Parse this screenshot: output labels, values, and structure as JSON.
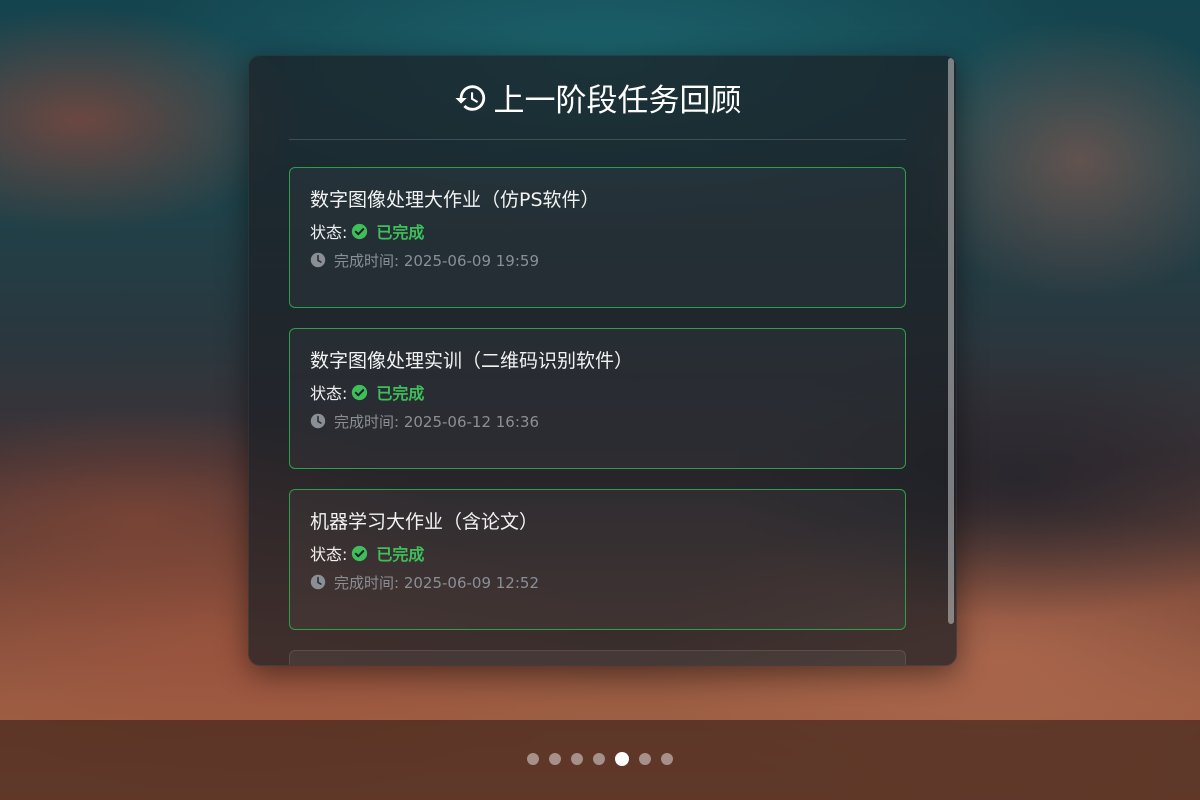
{
  "panel": {
    "title": "上一阶段任务回顾",
    "title_icon": "history-icon"
  },
  "tasks": [
    {
      "title": "数字图像处理大作业（仿PS软件）",
      "status_label": "状态:",
      "status_value": "已完成",
      "time_label": "完成时间: 2025-06-09 19:59"
    },
    {
      "title": "数字图像处理实训（二维码识别软件）",
      "status_label": "状态:",
      "status_value": "已完成",
      "time_label": "完成时间: 2025-06-12 16:36"
    },
    {
      "title": "机器学习大作业（含论文）",
      "status_label": "状态:",
      "status_value": "已完成",
      "time_label": "完成时间: 2025-06-09 12:52"
    }
  ],
  "pagination": {
    "total": 7,
    "active_index": 4
  },
  "colors": {
    "accent_green": "#3fbf5a",
    "card_border": "#2e9e4a"
  }
}
